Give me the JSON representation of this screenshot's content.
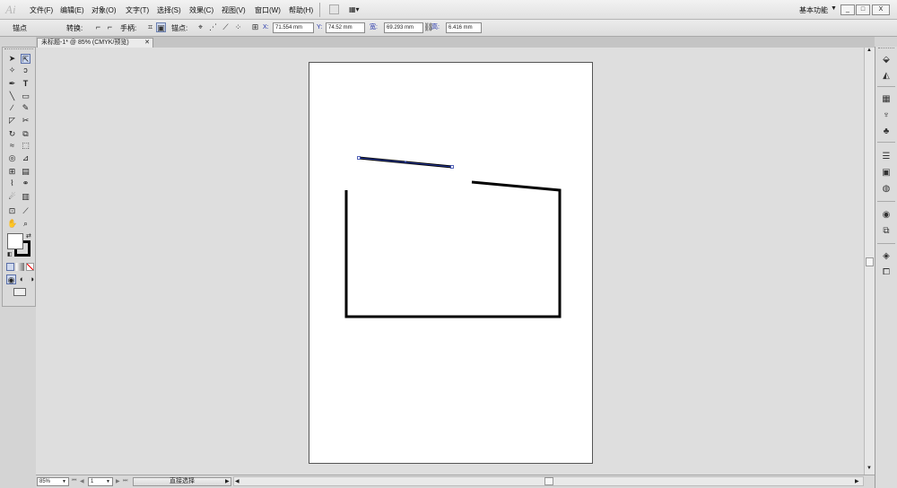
{
  "menubar": {
    "logo": "Ai",
    "items": [
      "文件(F)",
      "编辑(E)",
      "对象(O)",
      "文字(T)",
      "选择(S)",
      "效果(C)",
      "视图(V)",
      "窗口(W)",
      "帮助(H)"
    ],
    "workspace": "基本功能",
    "window_buttons": [
      "_",
      "□",
      "X"
    ]
  },
  "controlbar": {
    "anchor_label": "锚点",
    "convert_label": "转换:",
    "handles_label": "手柄:",
    "anchors_label": "锚点:",
    "x_label": "X:",
    "x_value": "71.554 mm",
    "y_label": "Y:",
    "y_value": "74.52 mm",
    "w_label": "宽:",
    "w_value": "69.293 mm",
    "h_label": "高:",
    "h_value": "6.416 mm"
  },
  "document": {
    "tab_title": "未标题-1* @ 85% (CMYK/预览)",
    "tab_close": "✕"
  },
  "statusbar": {
    "zoom": "85%",
    "page": "1",
    "tool_name": "直接选择"
  },
  "colors": {
    "selection": "#2a3ea8",
    "stroke": "#000000"
  }
}
